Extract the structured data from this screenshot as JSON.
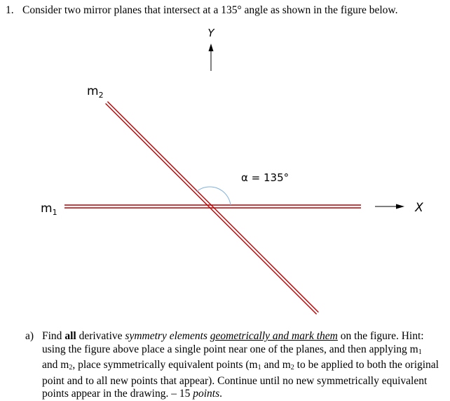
{
  "question": {
    "number": "1.",
    "text": "Consider two mirror planes that intersect at a 135° angle as shown in the figure below."
  },
  "figure": {
    "y_axis_label": "Y",
    "x_axis_label": "X",
    "mirror_1_label": "m",
    "mirror_1_sub": "1",
    "mirror_2_label": "m",
    "mirror_2_sub": "2",
    "angle_label": "α = 135°",
    "angle_degrees": 135,
    "mirror_color": "#c00000",
    "arc_color": "#7fb2e0",
    "axis_color": "#000000"
  },
  "part_a": {
    "label": "a)",
    "t1": "Find ",
    "t2_bold": "all",
    "t3": " derivative ",
    "t4_italic": "symmetry elements",
    "t5": " ",
    "t6_italic_underline": "geometrically and mark them",
    "t7": " on the figure.  Hint: using the figure above place a single point near one of the planes, and then applying m",
    "sub1": "1",
    "t8": " and m",
    "sub2": "2",
    "t9": ", place symmetrically equivalent points (m",
    "sub3": "1",
    "t10": " and m",
    "sub4": "2",
    "t11": " to be applied to both the original point and to all new points that appear). Continue until no new symmetrically equivalent points appear in the drawing. – 15 ",
    "t12_italic": "points",
    "t13": "."
  }
}
